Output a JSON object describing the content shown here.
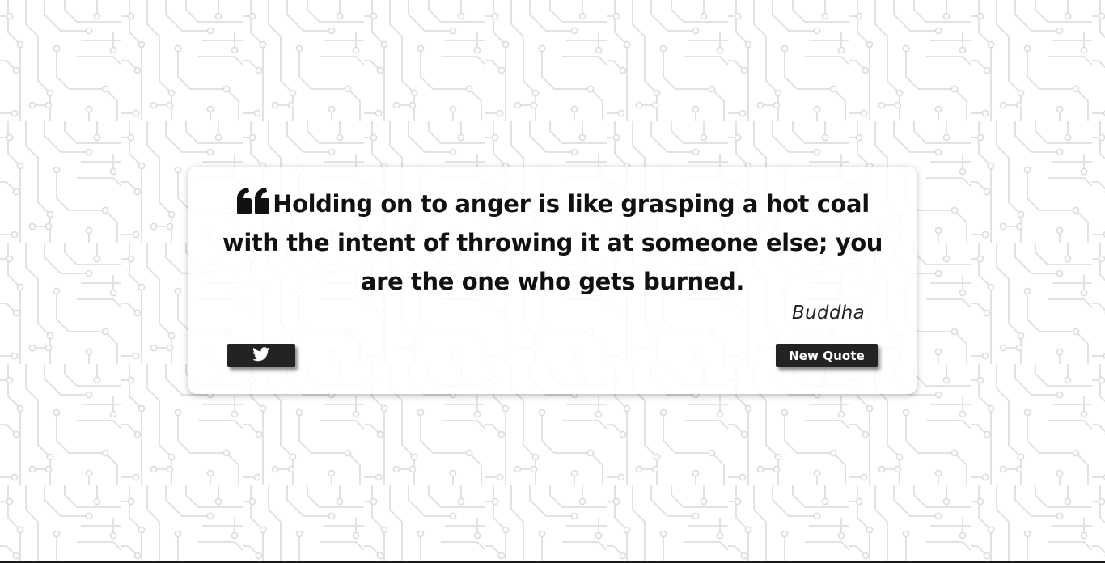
{
  "quote": {
    "text": "Holding on to anger is like grasping a hot coal with the intent of throwing it at someone else; you are the one who gets burned.",
    "author": "Buddha"
  },
  "buttons": {
    "tweet_icon": "twitter-icon",
    "new_quote_label": "New Quote"
  },
  "colors": {
    "button_bg": "#232323",
    "text": "#111111",
    "pattern": "#e3e3e3"
  }
}
